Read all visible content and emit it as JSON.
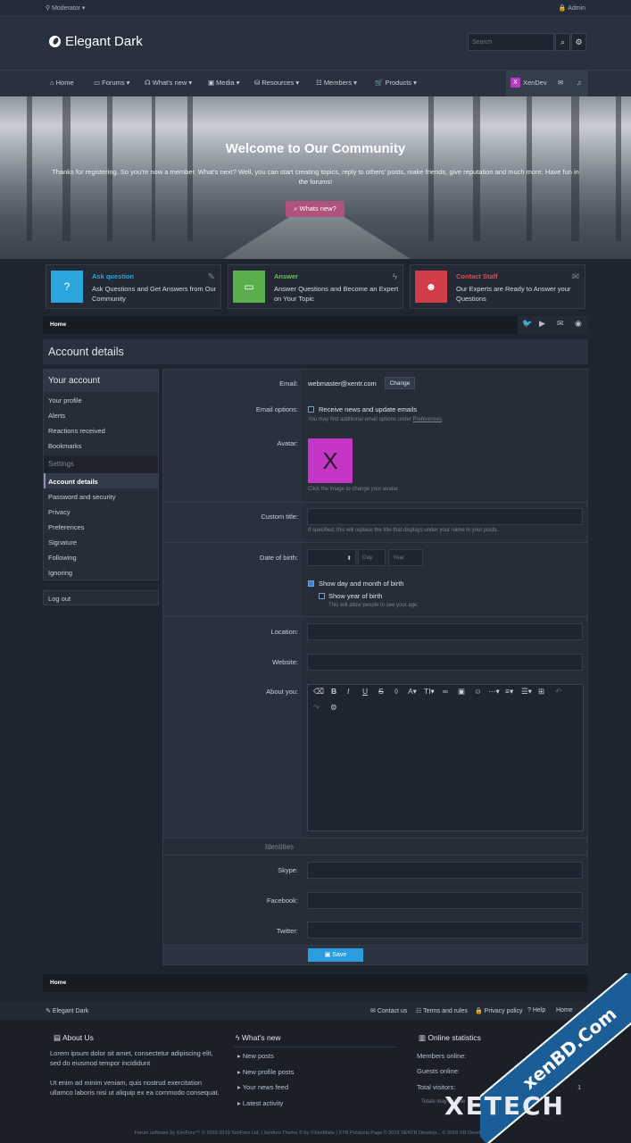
{
  "topbar": {
    "moderator": "Moderator",
    "admin": "Admin"
  },
  "header": {
    "site_title": "Elegant Dark",
    "search_placeholder": "Search"
  },
  "nav": {
    "items": [
      "Home",
      "Forums",
      "What's new",
      "Media",
      "Resources",
      "Members",
      "Products"
    ],
    "user": "XenDev"
  },
  "hero": {
    "title": "Welcome to Our Community",
    "text": "Thanks for registering. So you're now a member. What's next? Well, you can start creating topics, reply to others' posts, make friends, give reputation and much more. Have fun in the forums!",
    "button": "Whats new?"
  },
  "cards": [
    {
      "title": "Ask question",
      "desc": "Ask Questions and Get Answers from Our Community",
      "color": "#2aa6dc",
      "title_color": "#2aa6dc"
    },
    {
      "title": "Answer",
      "desc": "Answer Questions and Become an Expert on Your Topic",
      "color": "#5aae4d",
      "title_color": "#6cc05c"
    },
    {
      "title": "Contact Staff",
      "desc": "Our Experts are Ready to Answer your Questions",
      "color": "#d23d4a",
      "title_color": "#e04d5a"
    }
  ],
  "breadcrumb": "Home",
  "page_title": "Account details",
  "sidebar": {
    "head": "Your account",
    "items": [
      "Your profile",
      "Alerts",
      "Reactions received",
      "Bookmarks"
    ],
    "settings_label": "Settings",
    "settings": [
      "Account details",
      "Password and security",
      "Privacy",
      "Preferences",
      "Signature",
      "Following",
      "Ignoring"
    ],
    "logout": "Log out"
  },
  "form": {
    "email_label": "Email:",
    "email_value": "webmaster@xentr.com",
    "change": "Change",
    "email_options_label": "Email options:",
    "receive_news": "Receive news and update emails",
    "email_hint": "You may find additional email options under",
    "preferences_link": "Preferences",
    "avatar_label": "Avatar:",
    "avatar_letter": "X",
    "avatar_hint": "Click the image to change your avatar.",
    "custom_title_label": "Custom title:",
    "custom_title_hint": "If specified, this will replace the title that displays under your name in your posts.",
    "dob_label": "Date of birth:",
    "day_placeholder": "Day",
    "year_placeholder": "Year",
    "show_day_month": "Show day and month of birth",
    "show_year": "Show year of birth",
    "show_year_hint": "This will allow people to see your age.",
    "location_label": "Location:",
    "website_label": "Website:",
    "about_label": "About you:",
    "identities": "Identities",
    "skype_label": "Skype:",
    "facebook_label": "Facebook:",
    "twitter_label": "Twitter:",
    "save": "Save"
  },
  "footer": {
    "style": "Elegant Dark",
    "links": [
      "Contact us",
      "Terms and rules",
      "Privacy policy",
      "Help",
      "Home"
    ],
    "about_title": "About Us",
    "about_p1": "Lorem ipsum dolor sit amet, consectetur adipiscing elit, sed do eiusmod tempor incididunt",
    "about_p2": "Ut enim ad minim veniam, quis nostrud exercitation ullamco laboris nisi ut aliquip ex ea commodo consequat.",
    "whats_new_title": "What's new",
    "whats_new_items": [
      "New posts",
      "New profile posts",
      "Your news feed",
      "Latest activity"
    ],
    "stats_title": "Online statistics",
    "stats": [
      {
        "label": "Members online:",
        "value": ""
      },
      {
        "label": "Guests online:",
        "value": ""
      },
      {
        "label": "Total visitors:",
        "value": "1"
      }
    ],
    "stats_note": "Totals may include",
    "copyright": "Forum software by XenForo™ © 2010-2019 XenForo Ltd. | Xenforo Theme © by ©XenMake | XTR Products Page © 2019 XENTR Develop... © 2018 XR Development"
  },
  "watermark": {
    "text": "xenBD.Com",
    "brand": "XETECH"
  }
}
